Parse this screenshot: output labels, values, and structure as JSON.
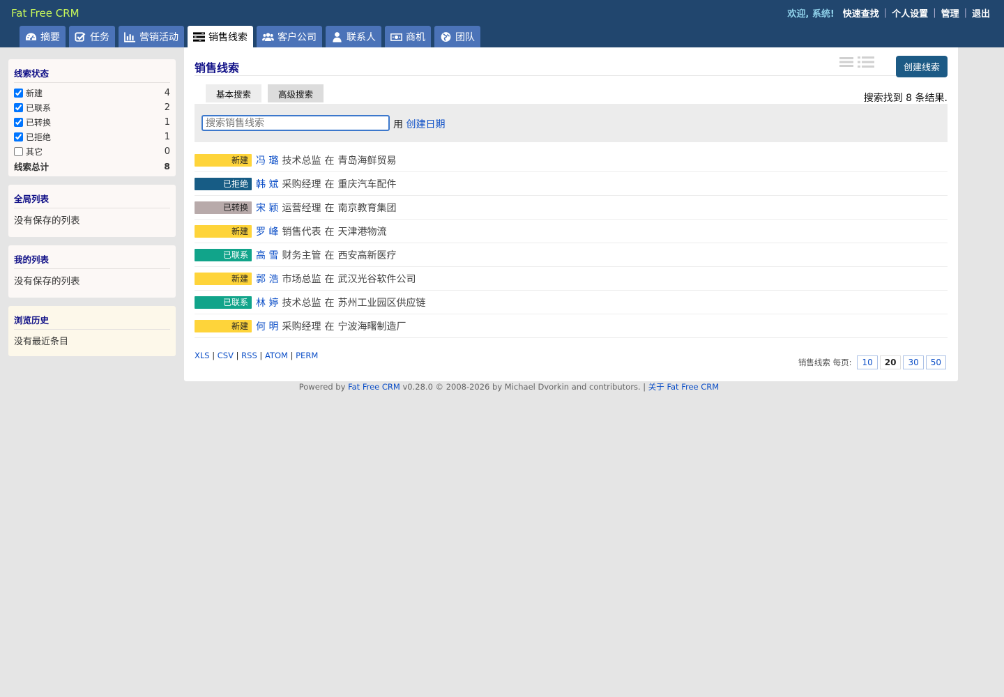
{
  "header": {
    "app_title": "Fat Free CRM",
    "welcome": "欢迎, 系统!",
    "links": [
      "快速查找",
      "个人设置",
      "管理",
      "退出"
    ]
  },
  "tabs": [
    {
      "label": "摘要",
      "icon": "dashboard-icon",
      "active": false
    },
    {
      "label": "任务",
      "icon": "check-square-icon",
      "active": false
    },
    {
      "label": "营销活动",
      "icon": "bar-chart-icon",
      "active": false
    },
    {
      "label": "销售线索",
      "icon": "leads-icon",
      "active": true
    },
    {
      "label": "客户公司",
      "icon": "users-icon",
      "active": false
    },
    {
      "label": "联系人",
      "icon": "user-icon",
      "active": false
    },
    {
      "label": "商机",
      "icon": "money-icon",
      "active": false
    },
    {
      "label": "团队",
      "icon": "globe-icon",
      "active": false
    }
  ],
  "sidebar": {
    "status": {
      "title": "线索状态",
      "items": [
        {
          "label": "新建",
          "count": "4",
          "checked": true
        },
        {
          "label": "已联系",
          "count": "2",
          "checked": true
        },
        {
          "label": "已转换",
          "count": "1",
          "checked": true
        },
        {
          "label": "已拒绝",
          "count": "1",
          "checked": true
        },
        {
          "label": "其它",
          "count": "0",
          "checked": false
        }
      ],
      "total_label": "线索总计",
      "total": "8"
    },
    "global_lists": {
      "title": "全局列表",
      "empty": "没有保存的列表"
    },
    "my_lists": {
      "title": "我的列表",
      "empty": "没有保存的列表"
    },
    "history": {
      "title": "浏览历史",
      "empty": "没有最近条目"
    }
  },
  "main": {
    "title": "销售线索",
    "create_button": "创建线索",
    "search_tabs": [
      "基本搜索",
      "高级搜索"
    ],
    "result_count": "搜索找到 8 条结果.",
    "search_placeholder": "搜索销售线索",
    "search_by_prefix": "用",
    "search_by_link": "创建日期",
    "at_word": "在"
  },
  "leads": [
    {
      "status": "新建",
      "name": "冯 璐",
      "title": "技术总监",
      "company": "青岛海鲜贸易"
    },
    {
      "status": "已拒绝",
      "name": "韩 斌",
      "title": "采购经理",
      "company": "重庆汽车配件"
    },
    {
      "status": "已转换",
      "name": "宋 颖",
      "title": "运营经理",
      "company": "南京教育集团"
    },
    {
      "status": "新建",
      "name": "罗 峰",
      "title": "销售代表",
      "company": "天津港物流"
    },
    {
      "status": "已联系",
      "name": "高 雪",
      "title": "财务主管",
      "company": "西安高新医疗"
    },
    {
      "status": "新建",
      "name": "郭 浩",
      "title": "市场总监",
      "company": "武汉光谷软件公司"
    },
    {
      "status": "已联系",
      "name": "林 婷",
      "title": "技术总监",
      "company": "苏州工业园区供应链"
    },
    {
      "status": "新建",
      "name": "何 明",
      "title": "采购经理",
      "company": "宁波海曙制造厂"
    }
  ],
  "status_colors": {
    "新建": {
      "bg": "#fed43a",
      "fg": "#222222"
    },
    "已拒绝": {
      "bg": "#175c85",
      "fg": "#ffffff"
    },
    "已转换": {
      "bg": "#b8aaaa",
      "fg": "#222222"
    },
    "已联系": {
      "bg": "#11a48a",
      "fg": "#ffffff"
    }
  },
  "exports": [
    "XLS",
    "CSV",
    "RSS",
    "ATOM",
    "PERM"
  ],
  "per_page": {
    "label": "销售线索 每页:",
    "options": [
      "10",
      "20",
      "30",
      "50"
    ],
    "selected": "20"
  },
  "footer": {
    "prefix": "Powered by",
    "app_link": "Fat Free CRM",
    "middle": "v0.28.0 © 2008-2026 by Michael Dvorkin and contributors. |",
    "about_link": "关于 Fat Free CRM"
  }
}
